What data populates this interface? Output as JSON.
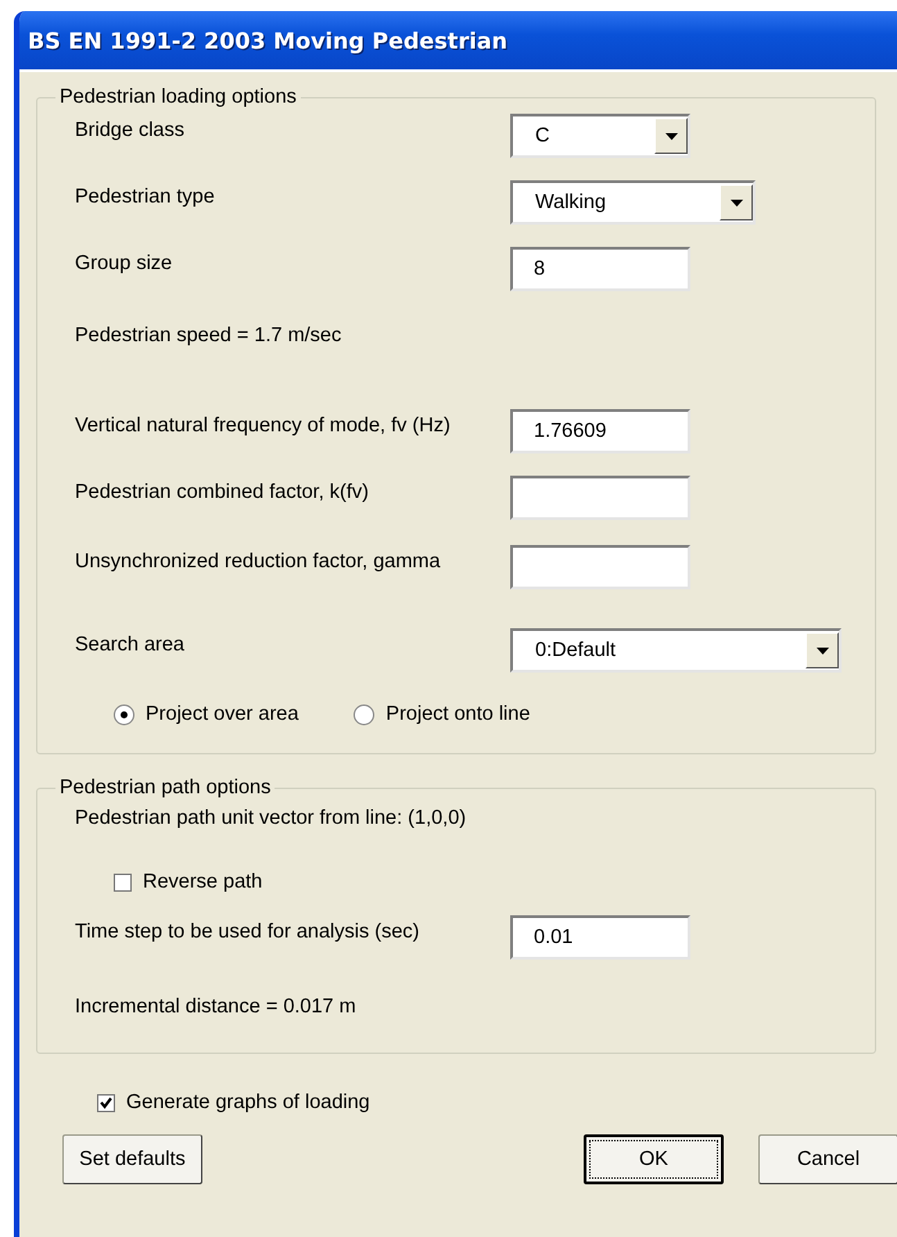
{
  "window": {
    "title": "BS EN 1991-2 2003 Moving Pedestrian"
  },
  "loading_options": {
    "title": "Pedestrian loading options",
    "rows": [
      {
        "kind": "dropdown",
        "label": "Bridge class",
        "value": "C"
      },
      {
        "kind": "dropdown",
        "label": "Pedestrian type",
        "value": "Walking"
      },
      {
        "kind": "text",
        "label": "Group size",
        "value": "8"
      },
      {
        "kind": "info",
        "label": "Pedestrian speed = 1.7 m/sec"
      },
      {
        "kind": "text",
        "label": "Vertical natural frequency of mode, fv (Hz)",
        "value": "1.76609"
      },
      {
        "kind": "text",
        "label": "Pedestrian combined factor, k(fv)",
        "value": ""
      },
      {
        "kind": "text",
        "label": "Unsynchronized reduction factor, gamma",
        "value": ""
      },
      {
        "kind": "dropdown",
        "label": "Search area",
        "value": "0:Default"
      }
    ],
    "radios": [
      {
        "label": "Project over area",
        "selected": true
      },
      {
        "label": "Project onto line",
        "selected": false
      }
    ]
  },
  "path_options": {
    "title": "Pedestrian path options",
    "unit_vector": "Pedestrian path unit vector from line: (1,0,0)",
    "reverse_path": {
      "label": "Reverse path",
      "checked": false
    },
    "time_step": {
      "label": "Time step to be used for analysis (sec)",
      "value": "0.01"
    },
    "incremental": "Incremental distance = 0.017 m"
  },
  "generate_graphs": {
    "label": "Generate graphs of loading",
    "checked": true
  },
  "buttons": [
    "Set defaults",
    "OK",
    "Cancel"
  ]
}
